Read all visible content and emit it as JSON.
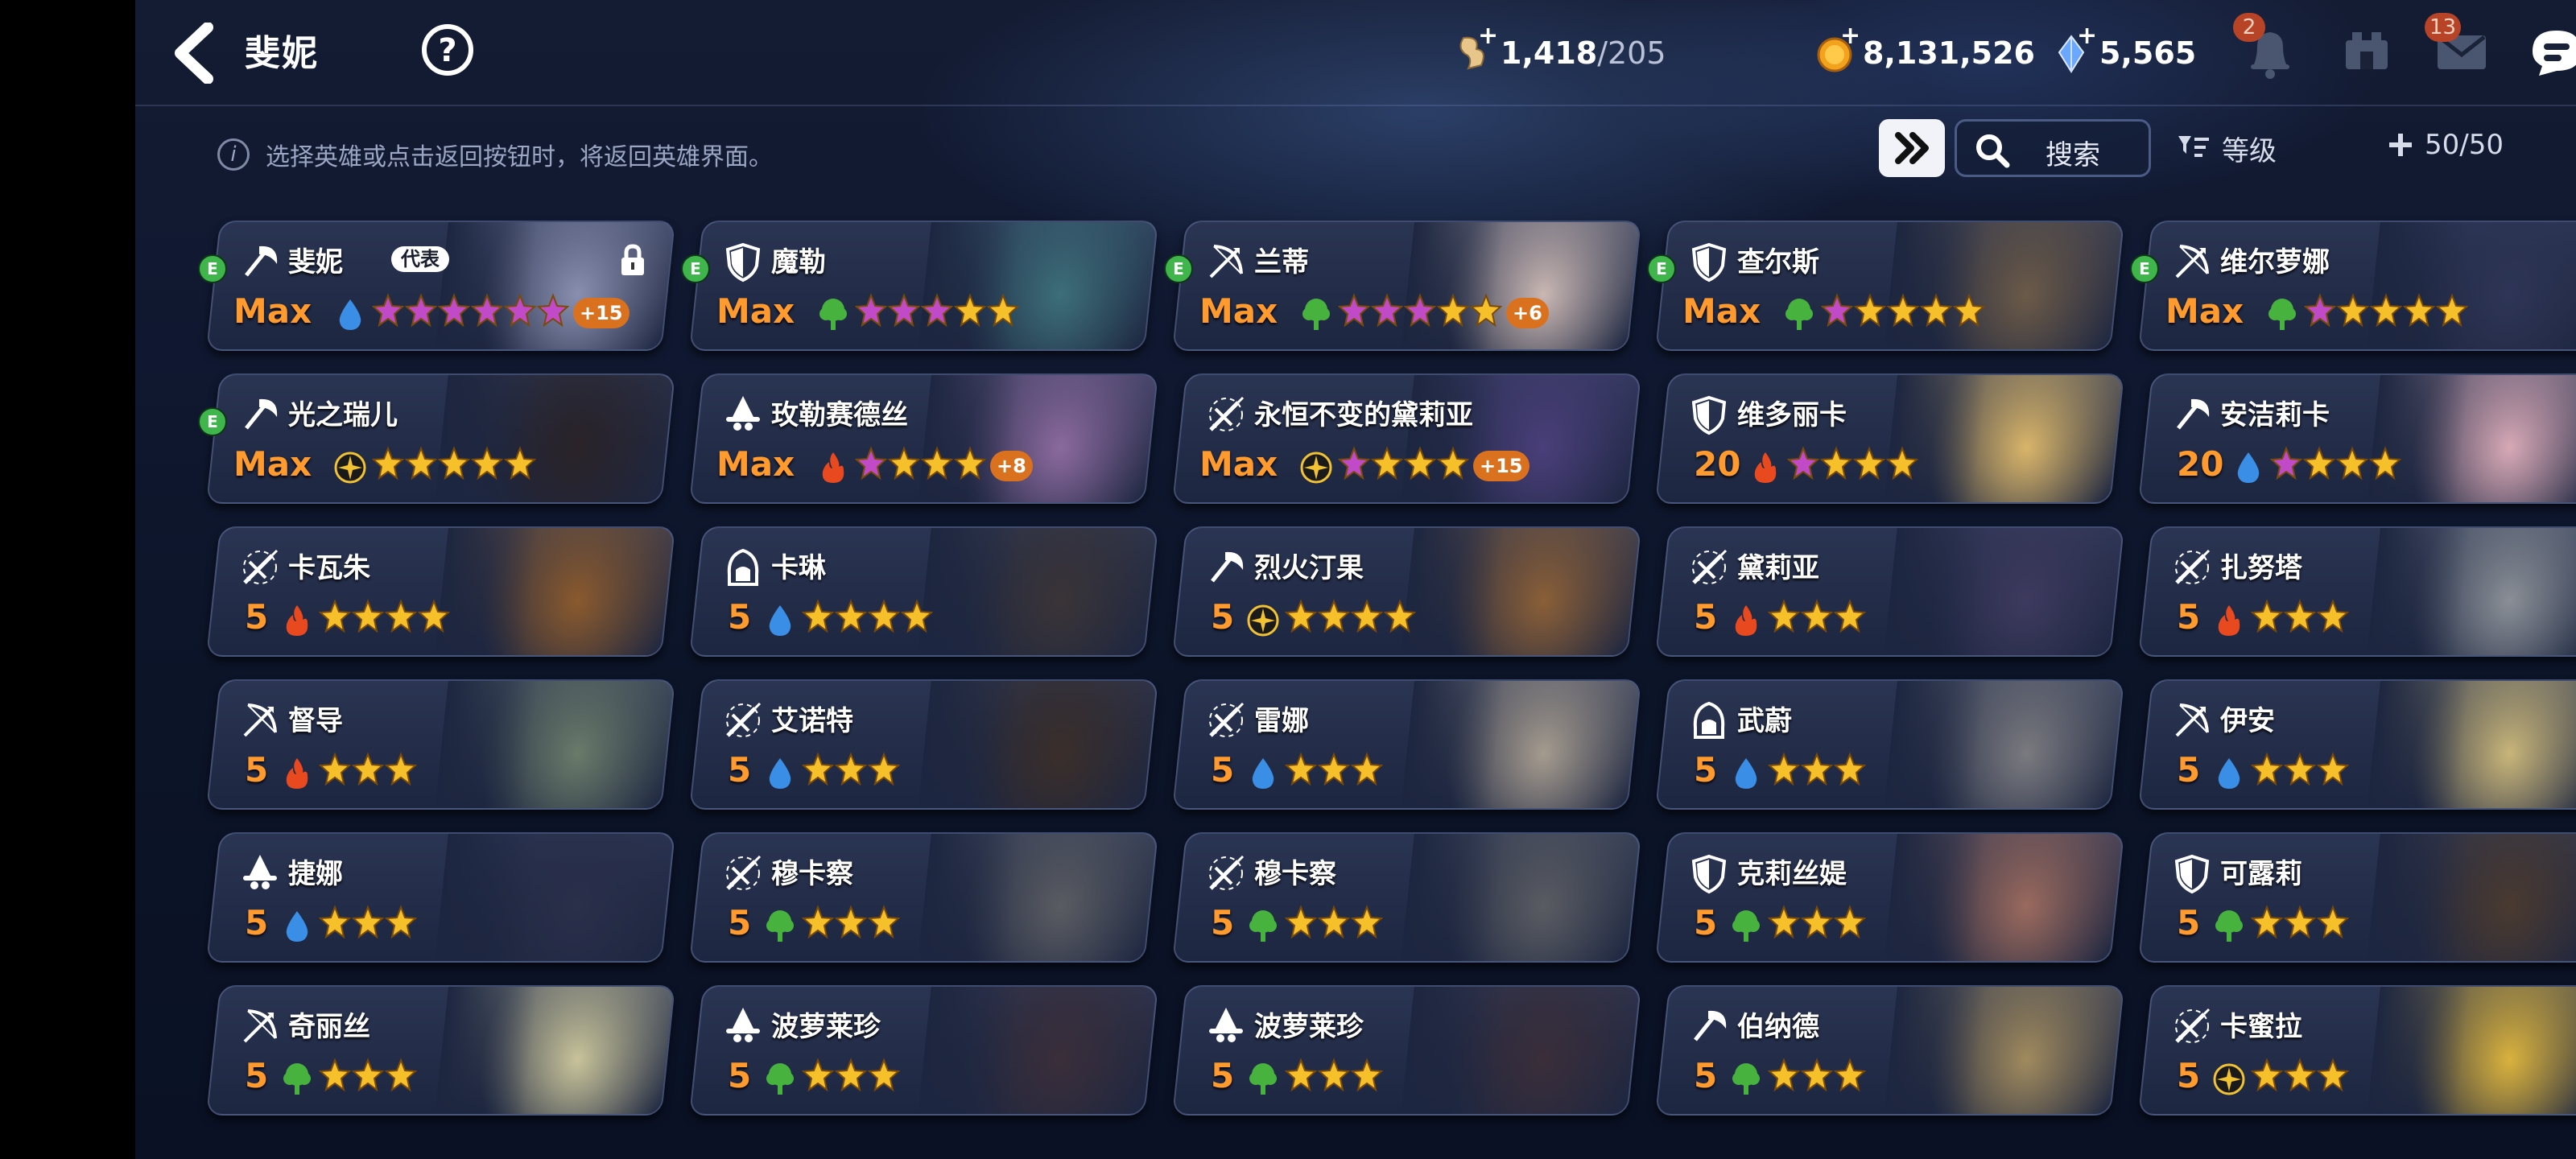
{
  "header": {
    "title": "斐妮",
    "help_label": "?",
    "resources": [
      {
        "name": "stamina-icon",
        "value": "1,418",
        "max": "/205"
      },
      {
        "name": "gold-coin-icon",
        "value": "8,131,526",
        "max": ""
      },
      {
        "name": "crystal-icon",
        "value": "5,565",
        "max": ""
      }
    ],
    "notifications_badge": "2",
    "mail_badge": "13"
  },
  "toolbar": {
    "notice": "选择英雄或点击返回按钮时，将返回英雄界面。",
    "notice_icon": "i",
    "search_label": "搜索",
    "sort_label": "等级",
    "count_label": "50/50"
  },
  "colors": {
    "level_text": "#ff9a2e",
    "plus_badge": "#d9711e",
    "evolution_badge": "#3fb54c",
    "water": "#3a8ee6",
    "wood": "#47b23e",
    "fire": "#e8491f",
    "light": "#f1c232"
  },
  "heroes": [
    {
      "name": "斐妮",
      "class": "scythe",
      "level": "Max",
      "element": "water",
      "stars": 6,
      "star_colors": "purple",
      "plus": "+15",
      "evolved": "E",
      "tag": "代表",
      "locked": true,
      "portrait": "#8a8fb0"
    },
    {
      "name": "魔勒",
      "class": "shield",
      "level": "Max",
      "element": "wood",
      "stars": 5,
      "star_colors": "mixed",
      "plus": "",
      "evolved": "E",
      "tag": "",
      "locked": false,
      "portrait": "#3d6e7a"
    },
    {
      "name": "兰蒂",
      "class": "bow",
      "level": "Max",
      "element": "wood",
      "stars": 5,
      "star_colors": "mixed",
      "plus": "+6",
      "evolved": "E",
      "tag": "",
      "locked": false,
      "portrait": "#c9b7b3"
    },
    {
      "name": "查尔斯",
      "class": "shield",
      "level": "Max",
      "element": "wood",
      "stars": 5,
      "star_colors": "gold",
      "plus": "",
      "evolved": "E",
      "tag": "",
      "locked": false,
      "portrait": "#6b5a48"
    },
    {
      "name": "维尔萝娜",
      "class": "bow",
      "level": "Max",
      "element": "wood",
      "stars": 5,
      "star_colors": "gold",
      "plus": "",
      "evolved": "E",
      "tag": "",
      "locked": false,
      "portrait": "#2e3556"
    },
    {
      "name": "光之瑞儿",
      "class": "scythe",
      "level": "Max",
      "element": "light",
      "stars": 5,
      "star_colors": "gold",
      "plus": "",
      "evolved": "E",
      "tag": "",
      "locked": false,
      "portrait": "#2a2328"
    },
    {
      "name": "玫勒赛德丝",
      "class": "witch",
      "level": "Max",
      "element": "fire",
      "stars": 4,
      "star_colors": "gold",
      "plus": "+8",
      "evolved": "",
      "tag": "",
      "locked": false,
      "portrait": "#8b6a9e"
    },
    {
      "name": "永恒不变的黛莉亚",
      "class": "sword",
      "level": "Max",
      "element": "light",
      "stars": 4,
      "star_colors": "gold",
      "plus": "+15",
      "evolved": "",
      "tag": "",
      "locked": false,
      "portrait": "#4a3f7a"
    },
    {
      "name": "维多丽卡",
      "class": "shield",
      "level": "20",
      "element": "fire",
      "stars": 4,
      "star_colors": "gold",
      "plus": "",
      "evolved": "",
      "tag": "",
      "locked": false,
      "portrait": "#d9b56a"
    },
    {
      "name": "安洁莉卡",
      "class": "scythe",
      "level": "20",
      "element": "water",
      "stars": 4,
      "star_colors": "gold",
      "plus": "",
      "evolved": "",
      "tag": "",
      "locked": false,
      "portrait": "#d7a9b6"
    },
    {
      "name": "卡瓦朱",
      "class": "sword",
      "level": "5",
      "element": "fire",
      "stars": 4,
      "star_colors": "gold",
      "plus": "",
      "evolved": "",
      "tag": "",
      "locked": false,
      "portrait": "#8a5a2e"
    },
    {
      "name": "卡琳",
      "class": "hood",
      "level": "5",
      "element": "water",
      "stars": 4,
      "star_colors": "gold",
      "plus": "",
      "evolved": "",
      "tag": "",
      "locked": false,
      "portrait": "#3a3437"
    },
    {
      "name": "烈火汀果",
      "class": "scythe",
      "level": "5",
      "element": "light",
      "stars": 4,
      "star_colors": "gold",
      "plus": "",
      "evolved": "",
      "tag": "",
      "locked": false,
      "portrait": "#8a5f38"
    },
    {
      "name": "黛莉亚",
      "class": "sword",
      "level": "5",
      "element": "fire",
      "stars": 3,
      "star_colors": "gold",
      "plus": "",
      "evolved": "",
      "tag": "",
      "locked": false,
      "portrait": "#3d3a5e"
    },
    {
      "name": "扎努塔",
      "class": "sword",
      "level": "5",
      "element": "fire",
      "stars": 3,
      "star_colors": "gold",
      "plus": "",
      "evolved": "",
      "tag": "",
      "locked": false,
      "portrait": "#8a8f96"
    },
    {
      "name": "督导",
      "class": "bow",
      "level": "5",
      "element": "fire",
      "stars": 3,
      "star_colors": "gold",
      "plus": "",
      "evolved": "",
      "tag": "",
      "locked": false,
      "portrait": "#6a7a6a"
    },
    {
      "name": "艾诺特",
      "class": "sword",
      "level": "5",
      "element": "water",
      "stars": 3,
      "star_colors": "gold",
      "plus": "",
      "evolved": "",
      "tag": "",
      "locked": false,
      "portrait": "#3a2e2a"
    },
    {
      "name": "雷娜",
      "class": "sword",
      "level": "5",
      "element": "water",
      "stars": 3,
      "star_colors": "gold",
      "plus": "",
      "evolved": "",
      "tag": "",
      "locked": false,
      "portrait": "#a59b8f"
    },
    {
      "name": "武蔚",
      "class": "hood",
      "level": "5",
      "element": "water",
      "stars": 3,
      "star_colors": "gold",
      "plus": "",
      "evolved": "",
      "tag": "",
      "locked": false,
      "portrait": "#7a7a7f"
    },
    {
      "name": "伊安",
      "class": "bow",
      "level": "5",
      "element": "water",
      "stars": 3,
      "star_colors": "gold",
      "plus": "",
      "evolved": "",
      "tag": "",
      "locked": false,
      "portrait": "#c8b57a"
    },
    {
      "name": "捷娜",
      "class": "witch",
      "level": "5",
      "element": "water",
      "stars": 3,
      "star_colors": "gold",
      "plus": "",
      "evolved": "",
      "tag": "",
      "locked": false,
      "portrait": "#2a2f4a"
    },
    {
      "name": "穆卡察",
      "class": "sword",
      "level": "5",
      "element": "wood",
      "stars": 3,
      "star_colors": "gold",
      "plus": "",
      "evolved": "",
      "tag": "",
      "locked": false,
      "portrait": "#5a5c62"
    },
    {
      "name": "穆卡察",
      "class": "sword",
      "level": "5",
      "element": "wood",
      "stars": 3,
      "star_colors": "gold",
      "plus": "",
      "evolved": "",
      "tag": "",
      "locked": false,
      "portrait": "#5a5c62"
    },
    {
      "name": "克莉丝媞",
      "class": "shield",
      "level": "5",
      "element": "wood",
      "stars": 3,
      "star_colors": "gold",
      "plus": "",
      "evolved": "",
      "tag": "",
      "locked": false,
      "portrait": "#9a6a5e"
    },
    {
      "name": "可露莉",
      "class": "shield",
      "level": "5",
      "element": "wood",
      "stars": 3,
      "star_colors": "gold",
      "plus": "",
      "evolved": "",
      "tag": "",
      "locked": false,
      "portrait": "#4a3a30"
    },
    {
      "name": "奇丽丝",
      "class": "bow",
      "level": "5",
      "element": "wood",
      "stars": 3,
      "star_colors": "gold",
      "plus": "",
      "evolved": "",
      "tag": "",
      "locked": false,
      "portrait": "#c8c39a"
    },
    {
      "name": "波萝莱珍",
      "class": "witch",
      "level": "5",
      "element": "wood",
      "stars": 3,
      "star_colors": "gold",
      "plus": "",
      "evolved": "",
      "tag": "",
      "locked": false,
      "portrait": "#3a2e3a"
    },
    {
      "name": "波萝莱珍",
      "class": "witch",
      "level": "5",
      "element": "wood",
      "stars": 3,
      "star_colors": "gold",
      "plus": "",
      "evolved": "",
      "tag": "",
      "locked": false,
      "portrait": "#3a2e3a"
    },
    {
      "name": "伯纳德",
      "class": "scythe",
      "level": "5",
      "element": "wood",
      "stars": 3,
      "star_colors": "gold",
      "plus": "",
      "evolved": "",
      "tag": "",
      "locked": false,
      "portrait": "#a08a5e"
    },
    {
      "name": "卡蜜拉",
      "class": "sword",
      "level": "5",
      "element": "light",
      "stars": 3,
      "star_colors": "gold",
      "plus": "",
      "evolved": "",
      "tag": "",
      "locked": false,
      "portrait": "#d9b23e"
    }
  ]
}
